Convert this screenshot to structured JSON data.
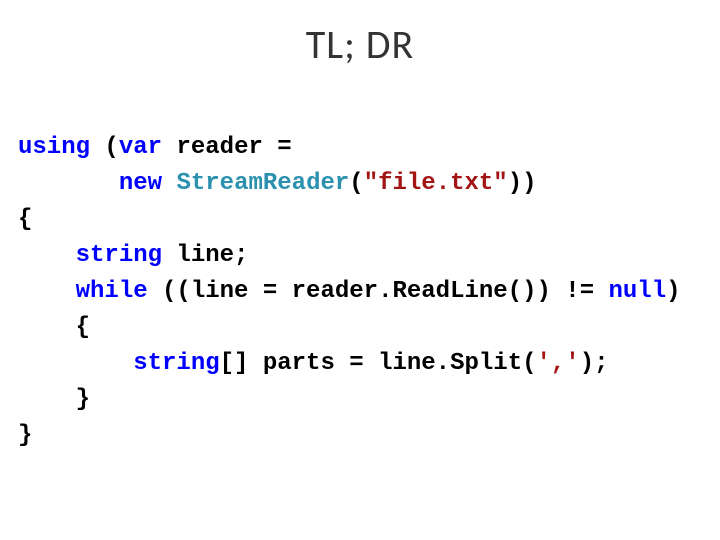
{
  "title": "TL; DR",
  "code": {
    "kw_using": "using",
    "kw_var": "var",
    "ident_reader": "reader",
    "eq": " =",
    "kw_new": "new",
    "type_streamreader": "StreamReader",
    "paren_open": "(",
    "str_file": "\"file.txt\"",
    "paren_close2": "))",
    "brace_open": "{",
    "kw_string": "string",
    "decl_line": " line;",
    "kw_while": "while",
    "while_cond": " ((line = reader.ReadLine()) != ",
    "kw_null": "null",
    "paren_close1": ")",
    "kw_string_arr": "string",
    "arr_decl": "[] parts = line.Split(",
    "char_comma": "','",
    "stmt_end": ");",
    "brace_close": "}"
  }
}
